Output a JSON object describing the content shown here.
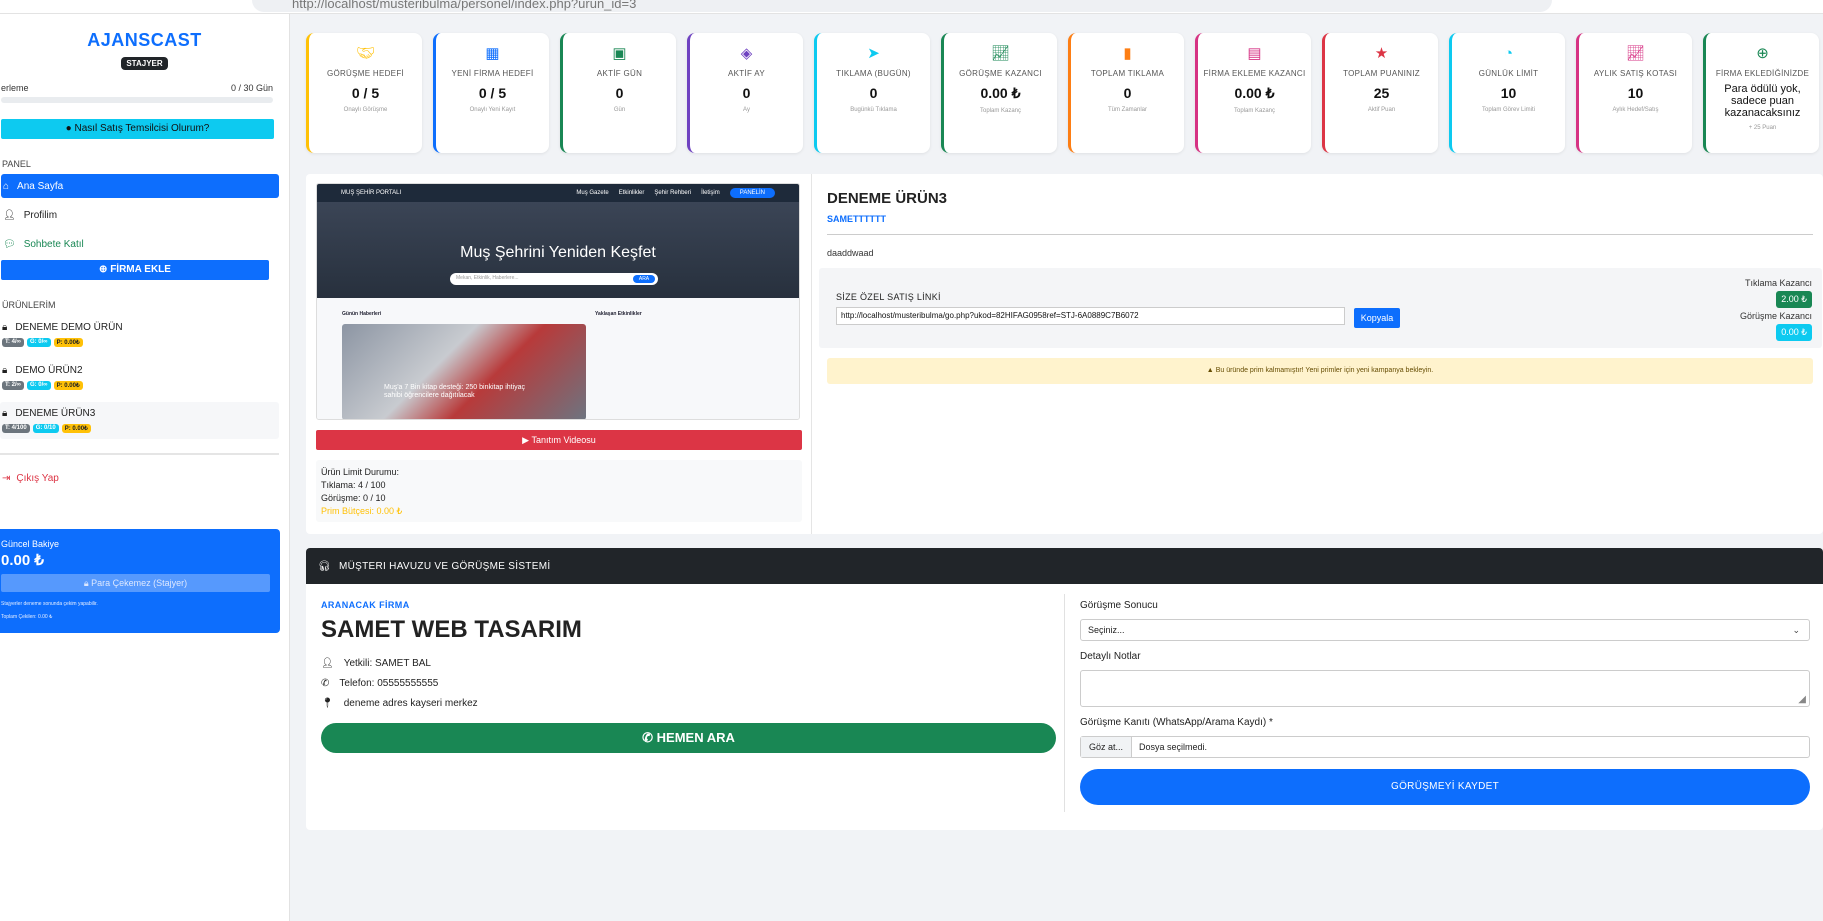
{
  "browser": {
    "url": "http://localhost/musteribulma/personel/index.php?urun_id=3"
  },
  "sidebar": {
    "brand": "AJANSCAST",
    "role_badge": "STAJYER",
    "progress_label": "erleme",
    "progress_value": "0 / 30 Gün",
    "info_button": "Nasıl Satış Temsilcisi Olurum?",
    "section_panel": "PANEL",
    "nav": [
      {
        "label": "Ana Sayfa",
        "icon": "home-icon",
        "active": true
      },
      {
        "label": "Profilim",
        "icon": "user-icon"
      },
      {
        "label": "Sohbete Katıl",
        "icon": "chat-icon"
      }
    ],
    "add_firm_button": "FİRMA EKLE",
    "section_products": "ÜRÜNLERİM",
    "products": [
      {
        "name": "DENEME DEMO ÜRÜN",
        "chips": [
          "T: 4/∞",
          "G: 0/∞",
          "P: 0.00₺"
        ]
      },
      {
        "name": "DEMO ÜRÜN2",
        "chips": [
          "T: 2/∞",
          "G: 0/∞",
          "P: 0.00₺"
        ]
      },
      {
        "name": "DENEME ÜRÜN3",
        "chips": [
          "T: 4/100",
          "G: 0/10",
          "P: 0.00₺"
        ]
      }
    ],
    "logout": "Çıkış Yap",
    "balance": {
      "label": "Güncel Bakiye",
      "value": "0.00 ₺",
      "withdraw": "Para Çekemez (Stajyer)",
      "note": "Stajyerler deneme sonunda çekim yapabilir.",
      "withdrawn": "Toplam Çekilen: 0.00 ₺"
    }
  },
  "stats": [
    {
      "icon": "handshake-icon",
      "color": "#ffc107",
      "label": "GÖRÜŞME HEDEFİ",
      "value": "0 / 5",
      "sub": "Onaylı Görüşme"
    },
    {
      "icon": "building-icon",
      "color": "#0d6efd",
      "label": "YENİ FİRMA HEDEFİ",
      "value": "0 / 5",
      "sub": "Onaylı Yeni Kayıt"
    },
    {
      "icon": "calendar-check-icon",
      "color": "#198754",
      "label": "AKTİF GÜN",
      "value": "0",
      "sub": "Gün"
    },
    {
      "icon": "layers-icon",
      "color": "#6f42c1",
      "label": "AKTİF AY",
      "value": "0",
      "sub": "Ay"
    },
    {
      "icon": "cursor-icon",
      "color": "#0dcaf0",
      "label": "TIKLAMA (BUGÜN)",
      "value": "0",
      "sub": "Bugünkü Tıklama"
    },
    {
      "icon": "chart-line-icon",
      "color": "#198754",
      "label": "GÖRÜŞME KAZANCI",
      "value": "0.00 ₺",
      "sub": "Toplam Kazanç"
    },
    {
      "icon": "bar-chart-icon",
      "color": "#fd7e14",
      "label": "TOPLAM TIKLAMA",
      "value": "0",
      "sub": "Tüm Zamanlar"
    },
    {
      "icon": "file-dollar-icon",
      "color": "#d63384",
      "label": "FİRMA EKLEME KAZANCI",
      "value": "0.00 ₺",
      "sub": "Toplam Kazanç"
    },
    {
      "icon": "star-icon",
      "color": "#dc3545",
      "label": "TOPLAM PUANINIZ",
      "value": "25",
      "sub": "Aktif Puan"
    },
    {
      "icon": "gauge-icon",
      "color": "#0dcaf0",
      "label": "GÜNLÜK LİMİT",
      "value": "10",
      "sub": "Toplam Görev Limiti"
    },
    {
      "icon": "trend-icon",
      "color": "#d63384",
      "label": "AYLIK SATIŞ KOTASI",
      "value": "10",
      "sub": "Aylık Hedef/Satış"
    },
    {
      "icon": "plus-circle-icon",
      "color": "#198754",
      "label": "FİRMA EKLEDİĞİNİZDE",
      "value": "Para ödülü yok, sadece puan kazanacaksınız",
      "sub": "+ 25 Puan"
    }
  ],
  "product": {
    "preview": {
      "nav_brand": "MUŞ ŞEHİR PORTALI",
      "nav_links": [
        "Muş Gazete",
        "Etkinlikler",
        "Şehir Rehberi",
        "İletişim"
      ],
      "nav_btn": "PANELİN",
      "hero": "Muş Şehrini Yeniden Keşfet",
      "search_ph": "Mekan, Etkinlik, Haberlere...",
      "search_btn": "ARA",
      "col1": "Günün Haberleri",
      "col2": "Yaklaşan Etkinlikler",
      "caption": "Muş'a 7 Bin kitap desteği: 250 binkitap ihtiyaç sahibi öğrencilere dağıtılacak"
    },
    "video_button": "Tanıtım Videosu",
    "limits": {
      "title": "Ürün Limit Durumu:",
      "clicks": "Tıklama: 4 / 100",
      "meetings": "Görüşme: 0 / 10",
      "bonus": "Prim Bütçesi: 0.00 ₺"
    },
    "title": "DENEME ÜRÜN3",
    "company": "SAMETTTTTT",
    "description": "daaddwaad",
    "link_label": "SİZE ÖZEL SATIŞ LİNKİ",
    "link": "http://localhost/musteribulma/go.php?ukod=82HIFAG0958ref=STJ-6A0889C7B6072",
    "copy_button": "Kopyala",
    "click_earn_label": "Tıklama Kazancı",
    "click_earn_value": "2.00 ₺",
    "meeting_earn_label": "Görüşme Kazancı",
    "meeting_earn_value": "0.00 ₺",
    "warning": "Bu üründe prim kalmamıştır! Yeni primler için yeni kampanya bekleyin."
  },
  "pool": {
    "header": "MÜŞTERI HAVUZU VE GÖRÜŞME SİSTEMİ",
    "call_label": "ARANACAK FİRMA",
    "firm_name": "SAMET WEB TASARIM",
    "contact": "Yetkili: SAMET BAL",
    "phone": "Telefon: 05555555555",
    "address": "deneme adres kayseri merkez",
    "call_button": "HEMEN ARA",
    "result_label": "Görüşme Sonucu",
    "result_value": "Seçiniz...",
    "notes_label": "Detaylı Notlar",
    "proof_label": "Görüşme Kanıtı (WhatsApp/Arama Kaydı) *",
    "file_button": "Göz at...",
    "file_status": "Dosya seçilmedi.",
    "save_button": "GÖRÜŞMEYİ KAYDET"
  }
}
